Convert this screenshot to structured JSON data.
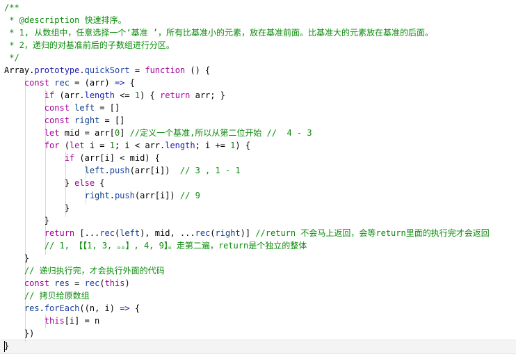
{
  "code_lines": [
    "/**",
    " * @description 快速排序。",
    " * 1, 从数组中，任意选择一个‘基准 ’，所有比基准小的元素，放在基准前面。比基准大的元素放在基准的后面。",
    " * 2，递归的对基准前后的子数组进行分区。",
    " */",
    "Array.prototype.quickSort = function () {",
    "    const rec = (arr) => {",
    "        if (arr.length <= 1) { return arr; }",
    "        const left = []",
    "        const right = []",
    "        let mid = arr[0] //定义一个基准,所以从第二位开始 //  4 - 3",
    "        for (let i = 1; i < arr.length; i += 1) {",
    "            if (arr[i] < mid) {",
    "                left.push(arr[i])  // 3 , 1 - 1",
    "            } else {",
    "                right.push(arr[i]) // 9",
    "            }",
    "        }",
    "        return [...rec(left), mid, ...rec(right)] //return 不会马上返回，会等return里面的执行完才会返回",
    "        // 1, 【【1, 3, 。。】, 4, 9】。走第二遍，return是个独立的整体",
    "    }",
    "    // 递归执行完，才会执行外面的代码",
    "    const res = rec(this)",
    "    // 拷贝给原数组",
    "    res.forEach((n, i) => {",
    "        this[i] = n",
    "    })",
    "}"
  ]
}
